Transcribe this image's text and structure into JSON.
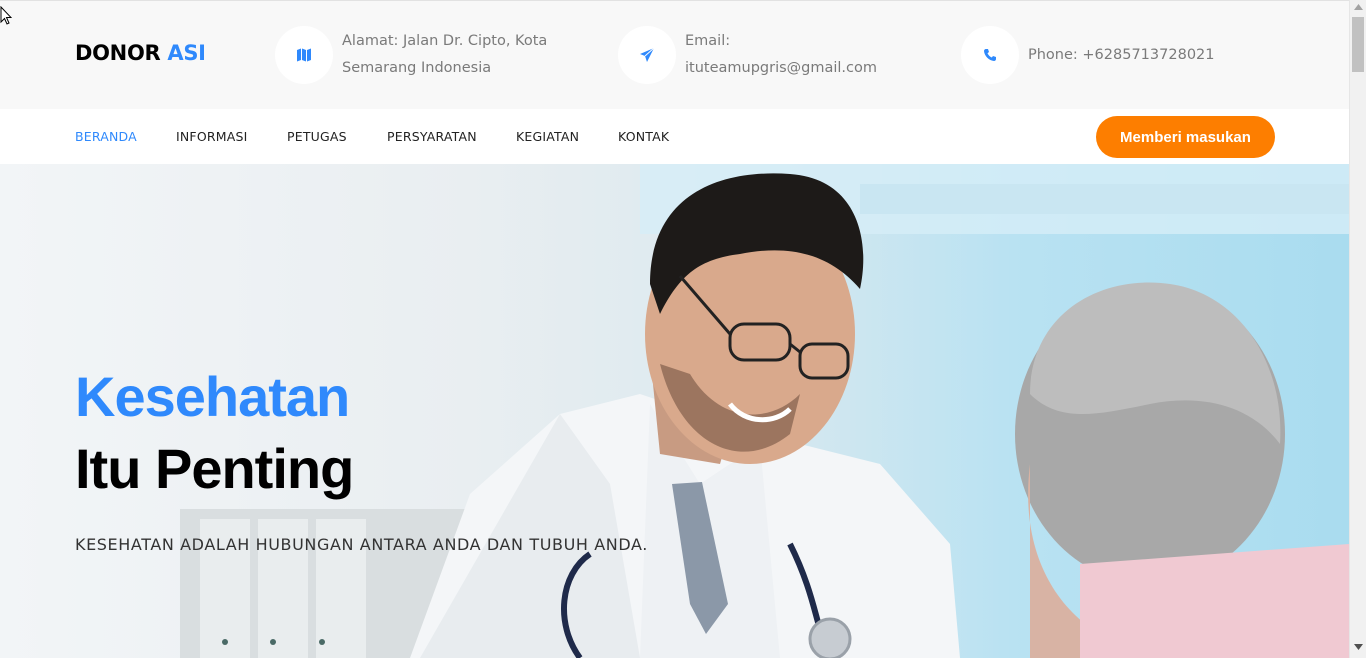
{
  "brand": {
    "name_part1": "DONOR",
    "name_part2": "ASI"
  },
  "contact": {
    "address_label": "Alamat: Jalan Dr. Cipto, Kota Semarang Indonesia",
    "email_label": "Email: ituteamupgris@gmail.com",
    "phone_label": "Phone: +6285713728021",
    "icons": [
      "map-icon",
      "paper-plane-icon",
      "phone-icon"
    ]
  },
  "nav": {
    "items": [
      {
        "label": "BERANDA",
        "active": true
      },
      {
        "label": "INFORMASI"
      },
      {
        "label": "PETUGAS"
      },
      {
        "label": "PERSYARATAN"
      },
      {
        "label": "KEGIATAN"
      },
      {
        "label": "KONTAK"
      }
    ],
    "cta_label": "Memberi masukan"
  },
  "hero": {
    "line1": "Kesehatan",
    "line2": "Itu Penting",
    "tagline": "KESEHATAN ADALAH HUBUNGAN ANTARA ANDA DAN TUBUH ANDA."
  },
  "colors": {
    "accent": "#2f89fc",
    "cta": "#fd7e00",
    "text_dark": "#000000",
    "muted": "#7a7a7a"
  }
}
